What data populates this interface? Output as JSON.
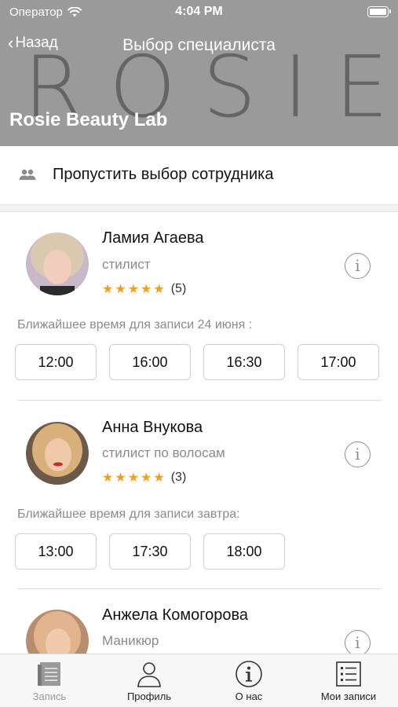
{
  "status_bar": {
    "carrier": "Оператор",
    "time": "4:04 PM"
  },
  "nav": {
    "back_label": "Назад",
    "title": "Выбор специалиста"
  },
  "brand": {
    "logo_text": "ROSIE",
    "salon_name": "Rosie Beauty Lab"
  },
  "skip": {
    "label": "Пропустить выбор сотрудника"
  },
  "specialists": [
    {
      "name": "Ламия Агаева",
      "role": "стилист",
      "stars": "★★★★★",
      "rating": 5,
      "reviews": "(5)",
      "nearest": "Ближайшее время для записи 24 июня :",
      "slots": [
        "12:00",
        "16:00",
        "16:30",
        "17:00"
      ]
    },
    {
      "name": "Анна Внукова",
      "role": "стилист по волосам",
      "stars": "★★★★★",
      "rating": 5,
      "reviews": "(3)",
      "nearest": "Ближайшее время для записи завтра:",
      "slots": [
        "13:00",
        "17:30",
        "18:00"
      ]
    },
    {
      "name": "Анжела Комогорова",
      "role": "Маникюр"
    }
  ],
  "tabs": [
    {
      "label": "Запись",
      "icon": "booking-book-icon",
      "enabled": false
    },
    {
      "label": "Профиль",
      "icon": "profile-person-icon",
      "enabled": true
    },
    {
      "label": "О нас",
      "icon": "info-circle-icon",
      "enabled": true
    },
    {
      "label": "Мои записи",
      "icon": "list-icon",
      "enabled": true
    }
  ],
  "colors": {
    "header_bg": "#9a9a9a",
    "star": "#f0a020",
    "muted_text": "#8a8a8a"
  }
}
